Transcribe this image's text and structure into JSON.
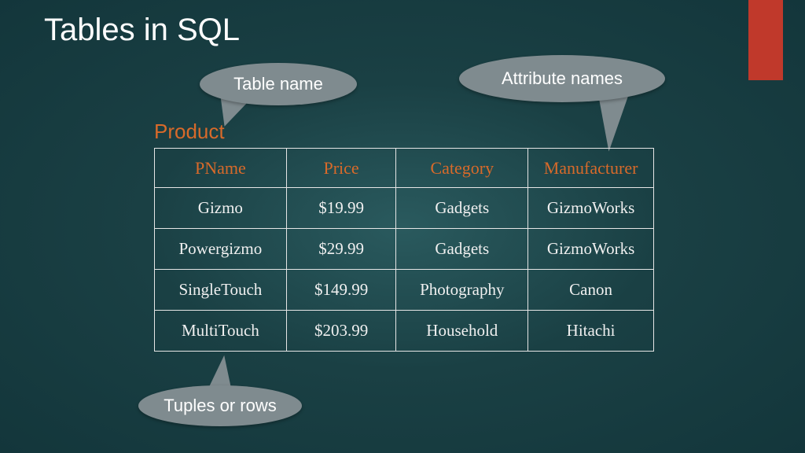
{
  "title": "Tables in SQL",
  "table_name": "Product",
  "callouts": {
    "table_name": "Table name",
    "attribute_names": "Attribute names",
    "tuples": "Tuples or rows"
  },
  "headers": [
    "PName",
    "Price",
    "Category",
    "Manufacturer"
  ],
  "rows": [
    {
      "c0": "Gizmo",
      "c1": "$19.99",
      "c2": "Gadgets",
      "c3": "GizmoWorks"
    },
    {
      "c0": "Powergizmo",
      "c1": "$29.99",
      "c2": "Gadgets",
      "c3": "GizmoWorks"
    },
    {
      "c0": "SingleTouch",
      "c1": "$149.99",
      "c2": "Photography",
      "c3": "Canon"
    },
    {
      "c0": "MultiTouch",
      "c1": "$203.99",
      "c2": "Household",
      "c3": "Hitachi"
    }
  ]
}
